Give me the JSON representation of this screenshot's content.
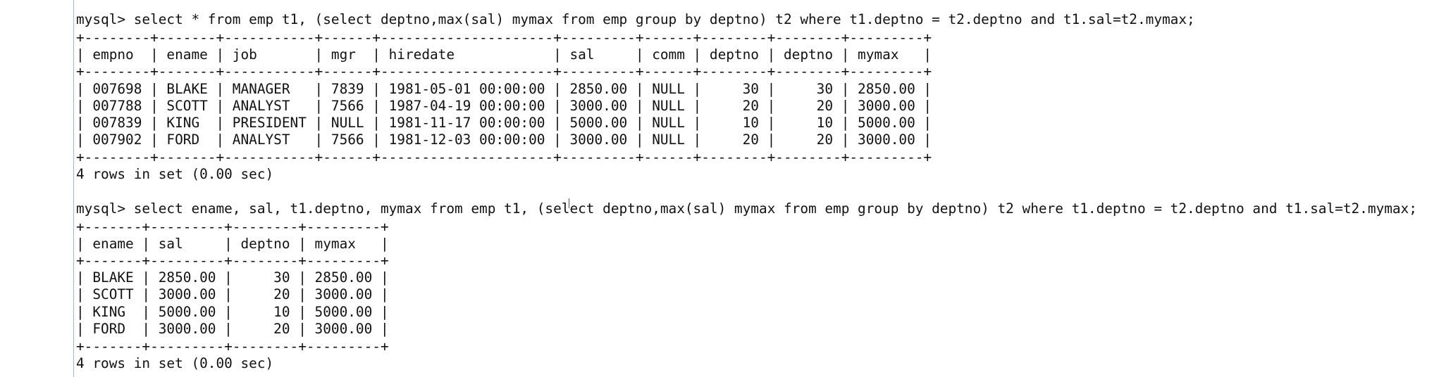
{
  "query1": {
    "command": "mysql> select * from emp t1, (select deptno,max(sal) mymax from emp group by deptno) t2 where t1.deptno = t2.deptno and t1.sal=t2.mymax;",
    "border": "+--------+-------+-----------+------+---------------------+---------+------+--------+--------+---------+",
    "header": "| empno  | ename | job       | mgr  | hiredate            | sal     | comm | deptno | deptno | mymax   |",
    "rows": [
      "| 007698 | BLAKE | MANAGER   | 7839 | 1981-05-01 00:00:00 | 2850.00 | NULL |     30 |     30 | 2850.00 |",
      "| 007788 | SCOTT | ANALYST   | 7566 | 1987-04-19 00:00:00 | 3000.00 | NULL |     20 |     20 | 3000.00 |",
      "| 007839 | KING  | PRESIDENT | NULL | 1981-11-17 00:00:00 | 5000.00 | NULL |     10 |     10 | 5000.00 |",
      "| 007902 | FORD  | ANALYST   | 7566 | 1981-12-03 00:00:00 | 3000.00 | NULL |     20 |     20 | 3000.00 |"
    ],
    "result": "4 rows in set (0.00 sec)"
  },
  "query2": {
    "command": "mysql> select ename, sal, t1.deptno, mymax from emp t1, (select deptno,max(sal) mymax from emp group by deptno) t2 where t1.deptno = t2.deptno and t1.sal=t2.mymax;",
    "border": "+-------+---------+--------+---------+",
    "header": "| ename | sal     | deptno | mymax   |",
    "rows": [
      "| BLAKE | 2850.00 |     30 | 2850.00 |",
      "| SCOTT | 3000.00 |     20 | 3000.00 |",
      "| KING  | 5000.00 |     10 | 5000.00 |",
      "| FORD  | 3000.00 |     20 | 3000.00 |"
    ],
    "result": "4 rows in set (0.00 sec)"
  }
}
